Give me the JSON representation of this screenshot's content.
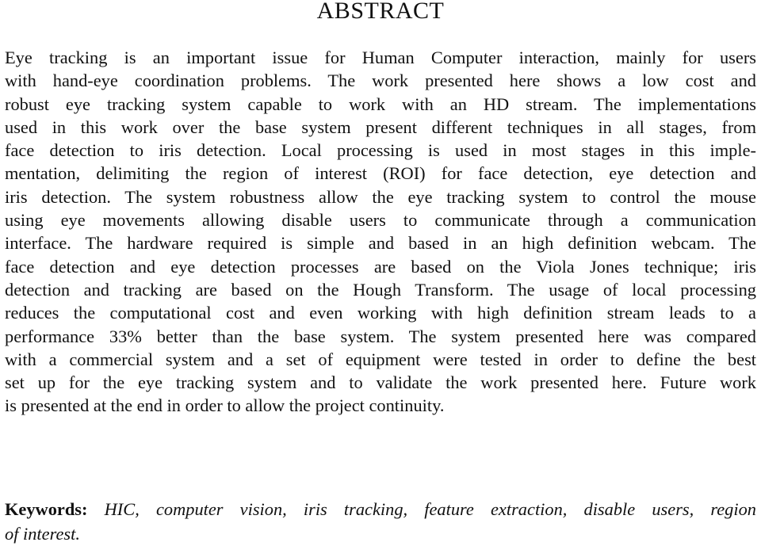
{
  "heading": "ABSTRACT",
  "abstract_lines": [
    "Eye tracking is an important issue for Human Computer interaction, mainly for users",
    "with hand-eye coordination problems.  The work presented here shows a low cost and",
    "robust eye tracking system capable to work with an HD stream.  The implementations",
    "used in this work over the base system present different techniques in all stages, from",
    "face detection to iris detection.  Local processing is used in most stages in this imple-",
    "mentation, delimiting the region of interest (ROI) for face detection, eye detection and",
    "iris detection. The system robustness allow the eye tracking system to control the mouse",
    "using eye movements allowing disable users to communicate through a communication",
    "interface. The hardware required is simple and based in an high definition webcam. The",
    "face detection and eye detection processes are based on the Viola Jones technique; iris",
    "detection and tracking are based on the Hough Transform. The usage of local processing",
    "reduces the computational cost and even working with high definition stream leads to a",
    "performance 33% better than the base system. The system presented here was compared",
    "with a commercial system and a set of equipment were tested in order to define the best",
    "set up for the eye tracking system and to validate the work presented here. Future work",
    "is presented at the end in order to allow the project continuity."
  ],
  "keywords": {
    "label": "Keywords:",
    "line1": "HIC, computer vision, iris tracking, feature extraction, disable users, region",
    "line2": "of interest."
  }
}
